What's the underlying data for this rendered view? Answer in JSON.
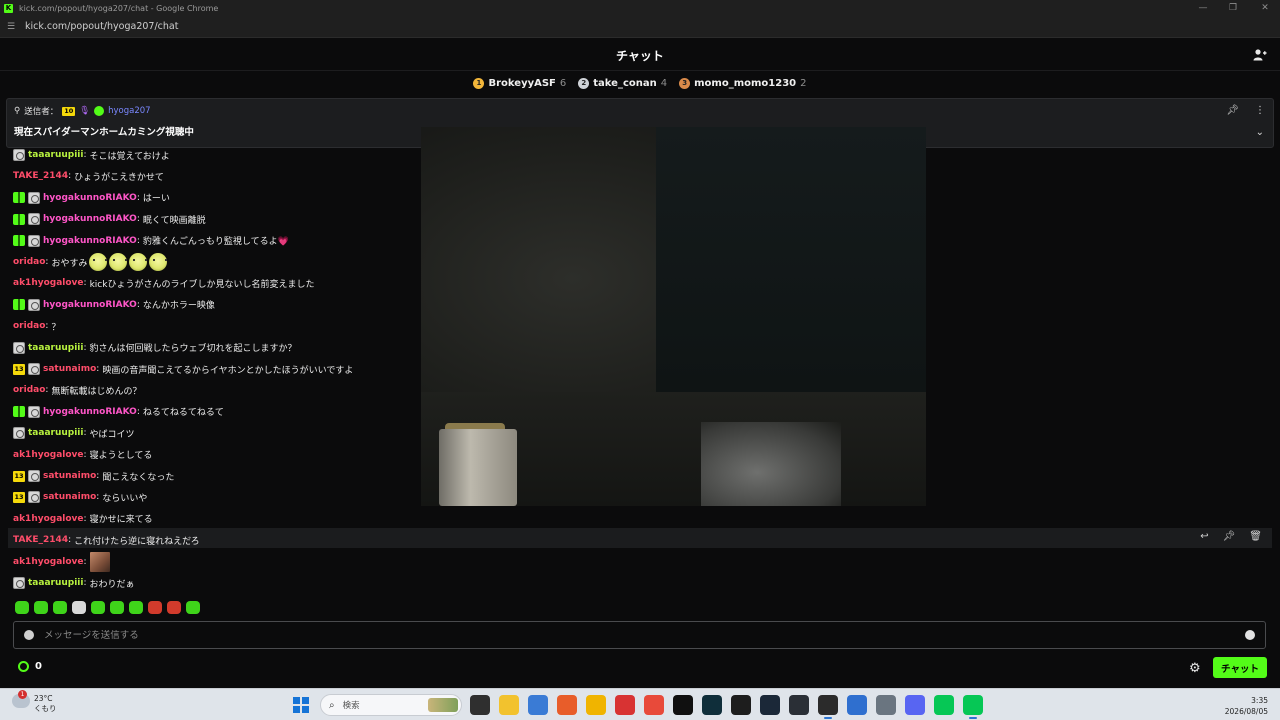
{
  "window": {
    "title": "kick.com/popout/hyoga207/chat - Google Chrome",
    "url": "kick.com/popout/hyoga207/chat"
  },
  "header": {
    "title": "チャット"
  },
  "leaderboard": [
    {
      "rank": "1",
      "name": "BrokeyyASF",
      "count": "6",
      "color": "#f2b63a"
    },
    {
      "rank": "2",
      "name": "take_conan",
      "count": "4",
      "color": "#cfd3d8"
    },
    {
      "rank": "3",
      "name": "momo_momo1230",
      "count": "2",
      "color": "#d98a4a"
    }
  ],
  "pinned": {
    "sender_label": "送信者：",
    "badge": "10",
    "user": "hyoga207",
    "message": "現在スパイダーマンホームカミング視聴中"
  },
  "messages": [
    {
      "badges": [
        "avatar"
      ],
      "user": "taaaruupiii",
      "color": "#b8f23f",
      "text": "そこは覚えておけよ"
    },
    {
      "badges": [],
      "user": "TAKE_2144",
      "color": "#ff4d6a",
      "text": "ひょうがこえきかせて"
    },
    {
      "badges": [
        "gift",
        "avatar"
      ],
      "user": "hyogakunnoRIAKO",
      "color": "#ff56c8",
      "text": "はーい"
    },
    {
      "badges": [
        "gift",
        "avatar"
      ],
      "user": "hyogakunnoRIAKO",
      "color": "#ff56c8",
      "text": "眠くて映画離脱"
    },
    {
      "badges": [
        "gift",
        "avatar"
      ],
      "user": "hyogakunnoRIAKO",
      "color": "#ff56c8",
      "text": "豹雅くんごんっもり監視してるよ💗"
    },
    {
      "badges": [],
      "user": "oridao",
      "color": "#ff4d6a",
      "text": "おやすみ",
      "emotes": 4
    },
    {
      "badges": [],
      "user": "ak1hyogalove",
      "color": "#ff4d6a",
      "text": "kickひょうがさんのライブしか見ないし名前変えました"
    },
    {
      "badges": [
        "gift",
        "avatar"
      ],
      "user": "hyogakunnoRIAKO",
      "color": "#ff56c8",
      "text": "なんかホラー映像"
    },
    {
      "badges": [],
      "user": "oridao",
      "color": "#ff4d6a",
      "text": "？"
    },
    {
      "badges": [
        "avatar"
      ],
      "user": "taaaruupiii",
      "color": "#b8f23f",
      "text": "豹さんは何回戦したらウェブ切れを起こしますか？"
    },
    {
      "badges": [
        "13",
        "avatar"
      ],
      "user": "satunaimo",
      "color": "#ff4d6a",
      "text": "映画の音声聞こえてるからイヤホンとかしたほうがいいですよ"
    },
    {
      "badges": [],
      "user": "oridao",
      "color": "#ff4d6a",
      "text": "無断転載はじめんの？"
    },
    {
      "badges": [
        "gift",
        "avatar"
      ],
      "user": "hyogakunnoRIAKO",
      "color": "#ff56c8",
      "text": "ねるてねるてねるて"
    },
    {
      "badges": [
        "avatar"
      ],
      "user": "taaaruupiii",
      "color": "#b8f23f",
      "text": "やばコイツ"
    },
    {
      "badges": [],
      "user": "ak1hyogalove",
      "color": "#ff4d6a",
      "text": "寝ようとしてる"
    },
    {
      "badges": [
        "13",
        "avatar"
      ],
      "user": "satunaimo",
      "color": "#ff4d6a",
      "text": "聞こえなくなった"
    },
    {
      "badges": [
        "13",
        "avatar"
      ],
      "user": "satunaimo",
      "color": "#ff4d6a",
      "text": "ならいいや"
    },
    {
      "badges": [],
      "user": "ak1hyogalove",
      "color": "#ff4d6a",
      "text": "寝かせに来てる"
    },
    {
      "badges": [],
      "user": "TAKE_2144",
      "color": "#ff4d6a",
      "text": "これ付けたら逆に寝れねえだろ",
      "highlight": true
    },
    {
      "badges": [],
      "user": "ak1hyogalove",
      "color": "#ff4d6a",
      "text": "",
      "image": true
    },
    {
      "badges": [
        "avatar"
      ],
      "user": "taaaruupiii",
      "color": "#b8f23f",
      "text": "おわりだぁ"
    }
  ],
  "input": {
    "placeholder": "メッセージを送信する"
  },
  "points": {
    "value": "0"
  },
  "send_button": {
    "label": "チャット"
  },
  "taskbar": {
    "weather_temp": "23°C",
    "weather_desc": "くもり",
    "weather_badge": "1",
    "search_label": "検索",
    "time": "3:35",
    "date": "2026/08/05"
  },
  "colors": {
    "accent": "#53fc18",
    "background": "#0b0b0c"
  }
}
